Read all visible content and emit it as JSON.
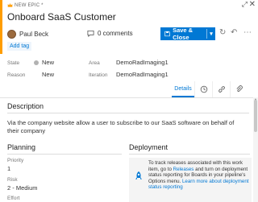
{
  "header": {
    "work_item_type": "NEW EPIC *",
    "title": "Onboard SaaS Customer"
  },
  "toolbar": {
    "assignee": "Paul Beck",
    "comments": "0 comments",
    "save_label": "Save & Close",
    "add_tag": "Add tag"
  },
  "fields": {
    "state_label": "State",
    "state_value": "New",
    "reason_label": "Reason",
    "reason_value": "New",
    "area_label": "Area",
    "area_value": "DemoRadImaging1",
    "iteration_label": "Iteration",
    "iteration_value": "DemoRadImaging1"
  },
  "tabs": {
    "details_label": "Details"
  },
  "description": {
    "heading": "Description",
    "text": "Via the company website allow a user to subscribe to our SaaS software on behalf of their company"
  },
  "planning": {
    "heading": "Planning",
    "priority_label": "Priority",
    "priority_value": "1",
    "risk_label": "Risk",
    "risk_value": "2 - Medium",
    "effort_label": "Effort"
  },
  "deployment": {
    "heading": "Deployment",
    "text_part1": "To track releases associated with this work item, go to ",
    "link1": "Releases",
    "text_part2": " and turn on deployment status reporting for Boards in your pipeline's Options menu. ",
    "link2": "Learn more about deployment status reporting"
  },
  "colors": {
    "accent": "#ff9d00",
    "primary": "#0078d4",
    "state_dot": "#b2b2b2"
  },
  "icons": [
    "crown-icon",
    "expand-icon",
    "close-icon",
    "avatar",
    "comment-icon",
    "save-icon",
    "refresh-icon",
    "undo-icon",
    "gear-icon",
    "history-icon",
    "link-icon",
    "attachment-icon",
    "rocket-icon"
  ]
}
